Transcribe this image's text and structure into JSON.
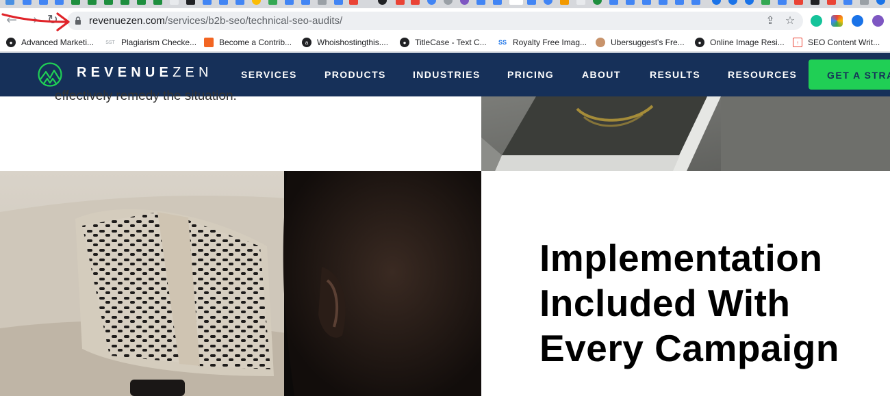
{
  "browser": {
    "url_domain": "revenuezen.com",
    "url_path": "/services/b2b-seo/technical-seo-audits/",
    "bookmarks": [
      {
        "label": "Advanced Marketi...",
        "icon": "globe-icon"
      },
      {
        "label": "Plagiarism Checke...",
        "icon": "sst-icon"
      },
      {
        "label": "Become a Contrib...",
        "icon": "orange-bird-icon"
      },
      {
        "label": "Whoishostingthis....",
        "icon": "whois-icon"
      },
      {
        "label": "TitleCase - Text C...",
        "icon": "globe-icon"
      },
      {
        "label": "Royalty Free Imag...",
        "icon": "sss-icon"
      },
      {
        "label": "Ubersuggest's Fre...",
        "icon": "avatar-icon"
      },
      {
        "label": "Online Image Resi...",
        "icon": "globe-icon"
      },
      {
        "label": "SEO Content Writ...",
        "icon": "seo-writer-icon"
      }
    ]
  },
  "site": {
    "brand_bold": "REVENUE",
    "brand_light": "ZEN",
    "nav": [
      "SERVICES",
      "PRODUCTS",
      "INDUSTRIES",
      "PRICING",
      "ABOUT",
      "RESULTS",
      "RESOURCES"
    ],
    "cta_label": "GET A STRATEGY"
  },
  "content": {
    "cut_text": "effectively remedy the situation.",
    "headline": "Implementation Included With Every Campaign"
  },
  "colors": {
    "header_bg": "#163059",
    "cta_bg": "#20cf55",
    "annotation_arrow": "#e0242a"
  }
}
